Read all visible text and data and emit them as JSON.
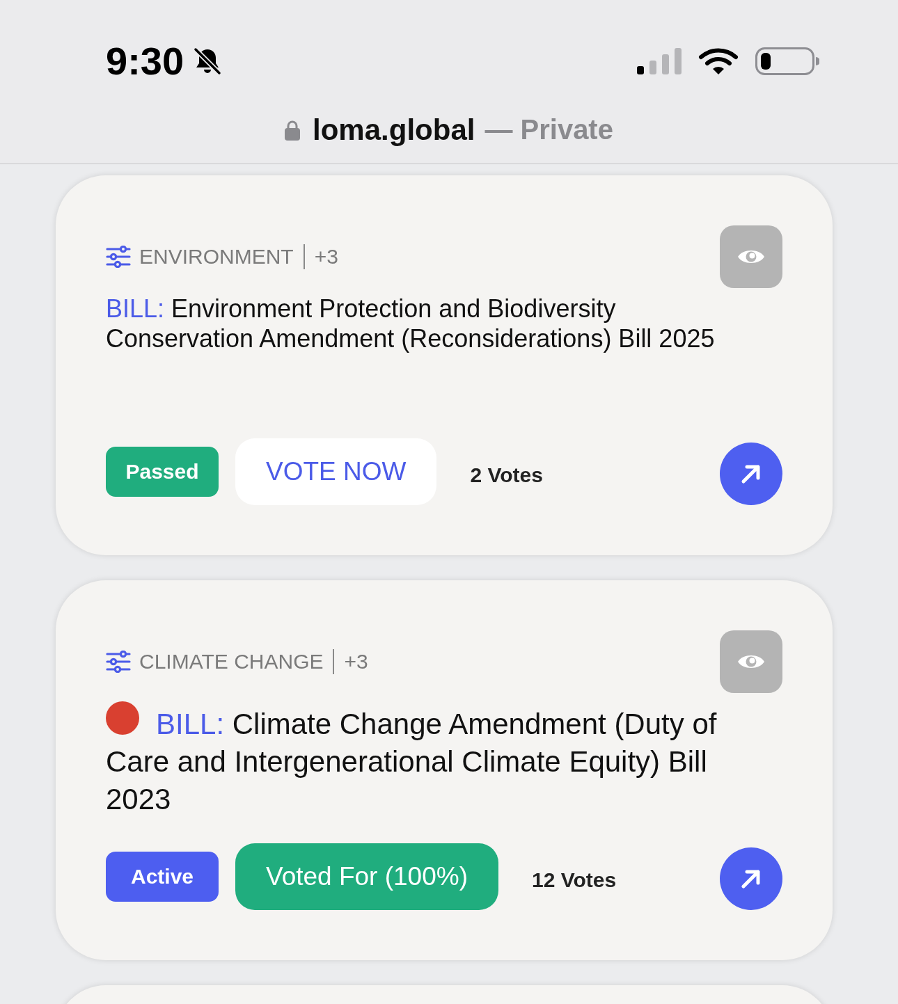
{
  "status_bar": {
    "time": "9:30"
  },
  "address_bar": {
    "domain": "loma.global",
    "suffix": "— Private"
  },
  "bills": [
    {
      "category": "ENVIRONMENT",
      "more_tags": "+3",
      "prefix": "BILL:",
      "title": "Environment Protection and Biodiversity Conservation Amendment (Reconsiderations) Bill 2025",
      "status": {
        "label": "Passed",
        "color": "#20ad7e"
      },
      "vote_button": {
        "label": "VOTE NOW",
        "voted": false
      },
      "votes": "2 Votes"
    },
    {
      "category": "CLIMATE CHANGE",
      "more_tags": "+3",
      "status_dot": {
        "color": "#d94030"
      },
      "prefix": "BILL:",
      "title": "Climate Change Amendment (Duty of Care and Intergenerational Climate Equity) Bill 2023",
      "status": {
        "label": "Active",
        "color": "#4d5ef0"
      },
      "vote_button": {
        "label": "Voted For (100%)",
        "voted": true
      },
      "votes": "12 Votes"
    }
  ]
}
